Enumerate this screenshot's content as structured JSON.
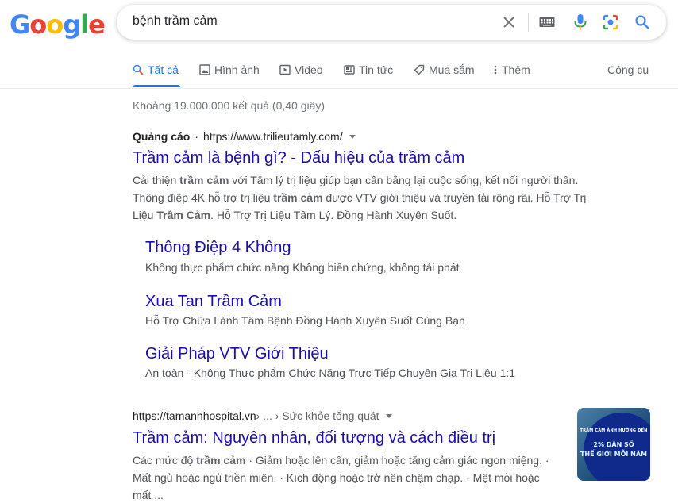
{
  "logo": {
    "letters": [
      "G",
      "o",
      "o",
      "g",
      "l",
      "e"
    ],
    "colors": [
      "#4285F4",
      "#EA4335",
      "#FBBC05",
      "#4285F4",
      "#34A853",
      "#EA4335"
    ]
  },
  "search": {
    "query": "bệnh trầm cảm",
    "icons": [
      "close-icon",
      "keyboard-icon",
      "microphone-icon",
      "camera-lens-icon",
      "search-icon"
    ]
  },
  "tabs": [
    {
      "label": "Tất cả",
      "icon": "search-icon"
    },
    {
      "label": "Hình ảnh",
      "icon": "image-icon"
    },
    {
      "label": "Video",
      "icon": "play-icon"
    },
    {
      "label": "Tin tức",
      "icon": "news-icon"
    },
    {
      "label": "Mua sắm",
      "icon": "tag-icon"
    },
    {
      "label": "Thêm",
      "icon": "more-vert-icon"
    }
  ],
  "tools_label": "Công cụ",
  "stats": "Khoảng 19.000.000 kết quả (0,40 giây)",
  "ad": {
    "label": "Quảng cáo",
    "url": "https://www.trilieutamly.com/",
    "title": "Trầm cảm là bệnh gì? - Dấu hiệu của trầm cảm",
    "snippet_lines": [
      [
        "Cải thiện ",
        "trầm cảm",
        " với Tâm lý trị liệu giúp bạn cân bằng lại cuộc sống, kết nối người thân."
      ],
      [
        "Thông điệp 4K hỗ trợ trị liệu ",
        "trầm cảm",
        " được VTV giới thiệu và truyền tải rộng rãi. Hỗ Trợ Trị"
      ],
      [
        "Liệu ",
        "Trầm Cảm",
        ". Hỗ Trợ Trị Liệu Tâm Lý. Đồng Hành Xuyên Suốt."
      ]
    ],
    "sitelinks": [
      {
        "title": "Thông Điệp 4 Không",
        "desc": "Không thực phẩm chức năng Không biến chứng, không tái phát"
      },
      {
        "title": "Xua Tan Trầm Cảm",
        "desc": "Hỗ Trợ Chữa Lành Tâm Bệnh Đồng Hành Xuyên Suốt Cùng Bạn"
      },
      {
        "title": "Giải Pháp VTV Giới Thiệu",
        "desc": "An toàn - Không Thực phẩm Chức Năng Trực Tiếp Chuyên Gia Trị Liệu 1:1"
      }
    ]
  },
  "result": {
    "domain": "https://tamanhhospital.vn",
    "breadcrumb": " › ... › Sức khỏe tổng quát",
    "title": "Trầm cảm: Nguyên nhân, đối tượng và cách điều trị",
    "snippet_lines": [
      [
        "Các mức độ ",
        "trầm cảm",
        " · Giảm hoặc lên cân, giảm hoặc tăng cảm giác ngon miệng. ·"
      ],
      [
        "Mất ngủ hoặc ngủ triền miên. · Kích động hoặc trở nên chậm chạp. · Mệt mỏi hoặc",
        "",
        ""
      ],
      [
        "mất ...",
        "",
        ""
      ]
    ],
    "thumbnail": {
      "line1": "TRẦM CẢM ẢNH HƯỞNG ĐẾN",
      "line2": "2% DÂN SỐ",
      "line3": "THẾ GIỚI MỖI NĂM"
    }
  }
}
